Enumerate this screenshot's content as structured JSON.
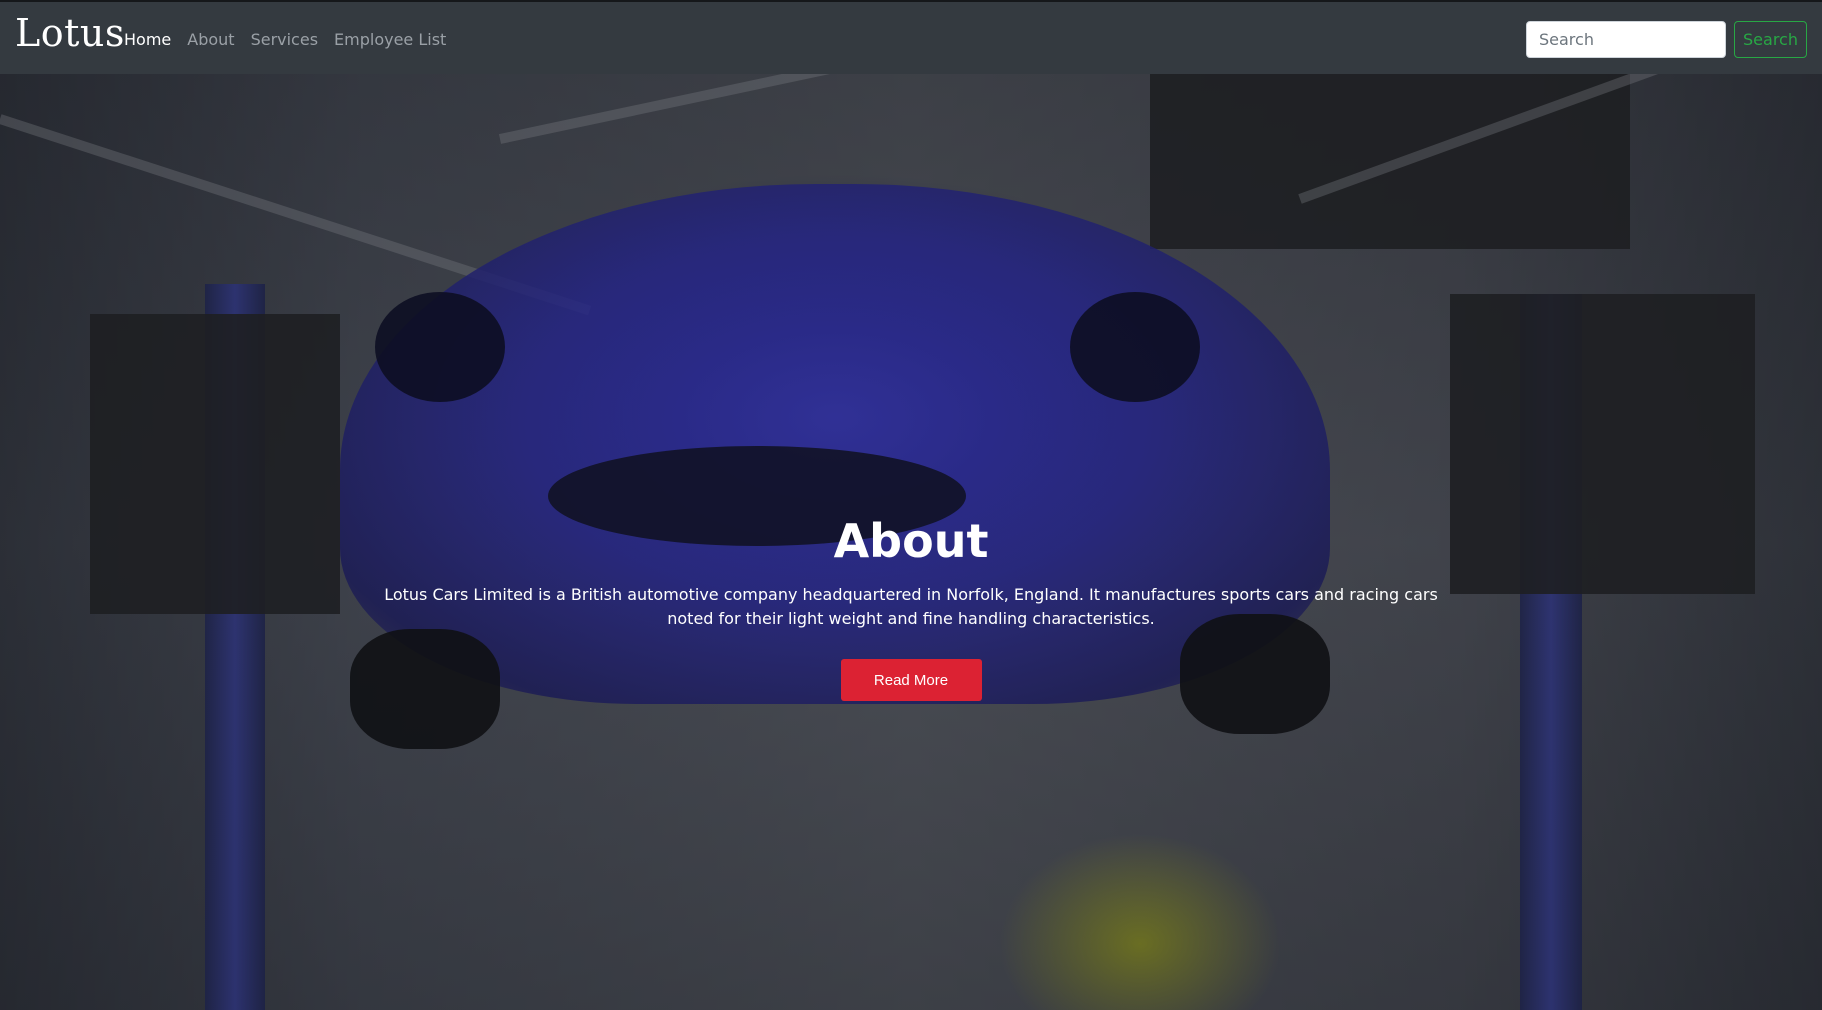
{
  "navbar": {
    "brand": "Lotus",
    "links": [
      {
        "label": "Home",
        "active": true
      },
      {
        "label": "About",
        "active": false
      },
      {
        "label": "Services",
        "active": false
      },
      {
        "label": "Employee List",
        "active": false
      }
    ],
    "search": {
      "placeholder": "Search",
      "value": "",
      "button_label": "Search"
    }
  },
  "hero": {
    "title": "About",
    "text": "Lotus Cars Limited is a British automotive company headquartered in Norfolk, England. It manufactures sports cars and racing cars noted for their light weight and fine handling characteristics.",
    "button_label": "Read More"
  },
  "colors": {
    "navbar_bg": "#343a40",
    "nav_link": "#9aa0a6",
    "nav_link_active": "#ffffff",
    "search_button": "#28a745",
    "read_more_bg": "#dc2233"
  }
}
